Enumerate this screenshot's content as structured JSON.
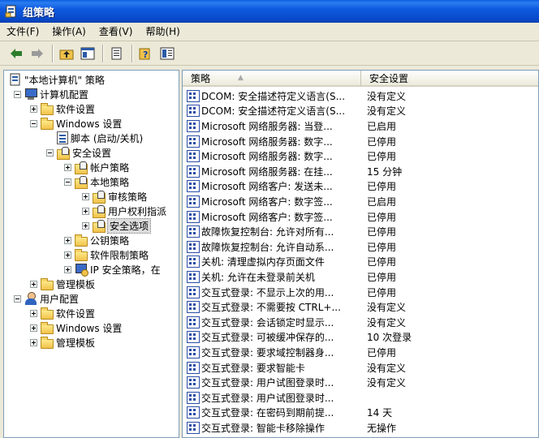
{
  "window": {
    "title": "组策略"
  },
  "menu": [
    "文件(F)",
    "操作(A)",
    "查看(V)",
    "帮助(H)"
  ],
  "toolbar": {
    "icons": [
      "back-arrow-icon",
      "forward-arrow-icon",
      "up-folder-icon",
      "show-tree-icon",
      "export-list-icon",
      "help-icon",
      "properties-icon"
    ]
  },
  "tree": [
    {
      "label": "\"本地计算机\" 策略",
      "icon": "policy-icon",
      "exp": "none"
    },
    {
      "label": "计算机配置",
      "icon": "computer-icon",
      "exp": "minus"
    },
    {
      "label": "软件设置",
      "icon": "folder-icon",
      "exp": "plus"
    },
    {
      "label": "Windows 设置",
      "icon": "folder-icon",
      "exp": "minus"
    },
    {
      "label": "脚本 (启动/关机)",
      "icon": "script-icon",
      "exp": "none"
    },
    {
      "label": "安全设置",
      "icon": "security-icon",
      "exp": "minus"
    },
    {
      "label": "帐户策略",
      "icon": "security-icon",
      "exp": "plus"
    },
    {
      "label": "本地策略",
      "icon": "security-icon",
      "exp": "minus"
    },
    {
      "label": "审核策略",
      "icon": "security-icon",
      "exp": "plus"
    },
    {
      "label": "用户权利指派",
      "icon": "security-icon",
      "exp": "plus"
    },
    {
      "label": "安全选项",
      "icon": "security-icon",
      "exp": "plus",
      "selected": true
    },
    {
      "label": "公钥策略",
      "icon": "folder-icon",
      "exp": "plus"
    },
    {
      "label": "软件限制策略",
      "icon": "folder-icon",
      "exp": "plus"
    },
    {
      "label": "IP 安全策略，在",
      "icon": "ipsec-icon",
      "exp": "plus"
    },
    {
      "label": "管理模板",
      "icon": "folder-icon",
      "exp": "plus"
    },
    {
      "label": "用户配置",
      "icon": "user-icon",
      "exp": "minus"
    },
    {
      "label": "软件设置",
      "icon": "folder-icon",
      "exp": "plus"
    },
    {
      "label": "Windows 设置",
      "icon": "folder-icon",
      "exp": "plus"
    },
    {
      "label": "管理模板",
      "icon": "folder-icon",
      "exp": "plus"
    }
  ],
  "list": {
    "col_policy": "策略",
    "col_setting": "安全设置",
    "rows": [
      {
        "policy": "DCOM: 安全描述符定义语言(S...",
        "value": "没有定义"
      },
      {
        "policy": "DCOM: 安全描述符定义语言(S...",
        "value": "没有定义"
      },
      {
        "policy": "Microsoft 网络服务器: 当登...",
        "value": "已启用"
      },
      {
        "policy": "Microsoft 网络服务器: 数字...",
        "value": "已停用"
      },
      {
        "policy": "Microsoft 网络服务器: 数字...",
        "value": "已停用"
      },
      {
        "policy": "Microsoft 网络服务器: 在挂...",
        "value": "15 分钟"
      },
      {
        "policy": "Microsoft 网络客户: 发送未...",
        "value": "已停用"
      },
      {
        "policy": "Microsoft 网络客户: 数字签...",
        "value": "已启用"
      },
      {
        "policy": "Microsoft 网络客户: 数字签...",
        "value": "已停用"
      },
      {
        "policy": "故障恢复控制台: 允许对所有...",
        "value": "已停用"
      },
      {
        "policy": "故障恢复控制台: 允许自动系...",
        "value": "已停用"
      },
      {
        "policy": "关机: 清理虚拟内存页面文件",
        "value": "已停用"
      },
      {
        "policy": "关机: 允许在未登录前关机",
        "value": "已停用"
      },
      {
        "policy": "交互式登录: 不显示上次的用...",
        "value": "已停用"
      },
      {
        "policy": "交互式登录: 不需要按 CTRL+...",
        "value": "没有定义"
      },
      {
        "policy": "交互式登录: 会话锁定时显示...",
        "value": "没有定义"
      },
      {
        "policy": "交互式登录: 可被缓冲保存的...",
        "value": "10 次登录"
      },
      {
        "policy": "交互式登录: 要求域控制器身...",
        "value": "已停用"
      },
      {
        "policy": "交互式登录: 要求智能卡",
        "value": "没有定义"
      },
      {
        "policy": "交互式登录: 用户试图登录时...",
        "value": "没有定义"
      },
      {
        "policy": "交互式登录: 用户试图登录时...",
        "value": ""
      },
      {
        "policy": "交互式登录: 在密码到期前提...",
        "value": "14 天"
      },
      {
        "policy": "交互式登录: 智能卡移除操作",
        "value": "无操作"
      }
    ]
  }
}
